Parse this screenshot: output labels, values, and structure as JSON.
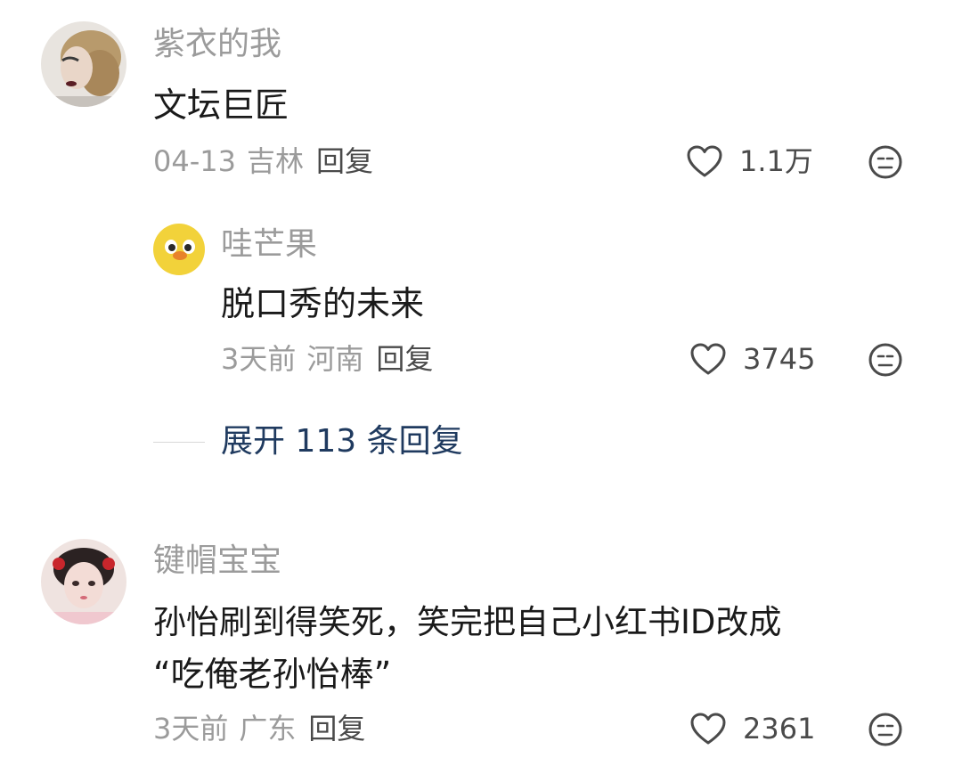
{
  "comments": [
    {
      "username": "紫衣的我",
      "text": "文坛巨匠",
      "date": "04-13",
      "location": "吉林",
      "reply_label": "回复",
      "likes": "1.1万",
      "replies": [
        {
          "username": "哇芒果",
          "text": "脱口秀的未来",
          "date": "3天前",
          "location": "河南",
          "reply_label": "回复",
          "likes": "3745"
        }
      ],
      "expand_label": "展开 113 条回复"
    },
    {
      "username": "键帽宝宝",
      "text_line1": "孙怡刷到得笑死，笑完把自己小红书ID改成",
      "text_line2": "“吃俺老孙怡棒”",
      "date": "3天前",
      "location": "广东",
      "reply_label": "回复",
      "likes": "2361"
    }
  ],
  "icons": {
    "like": "heart-outline-icon",
    "dislike": "neutral-face-icon"
  },
  "colors": {
    "username": "#9b9b9b",
    "text": "#1a1a1a",
    "expand_link": "#1f3a5f"
  }
}
